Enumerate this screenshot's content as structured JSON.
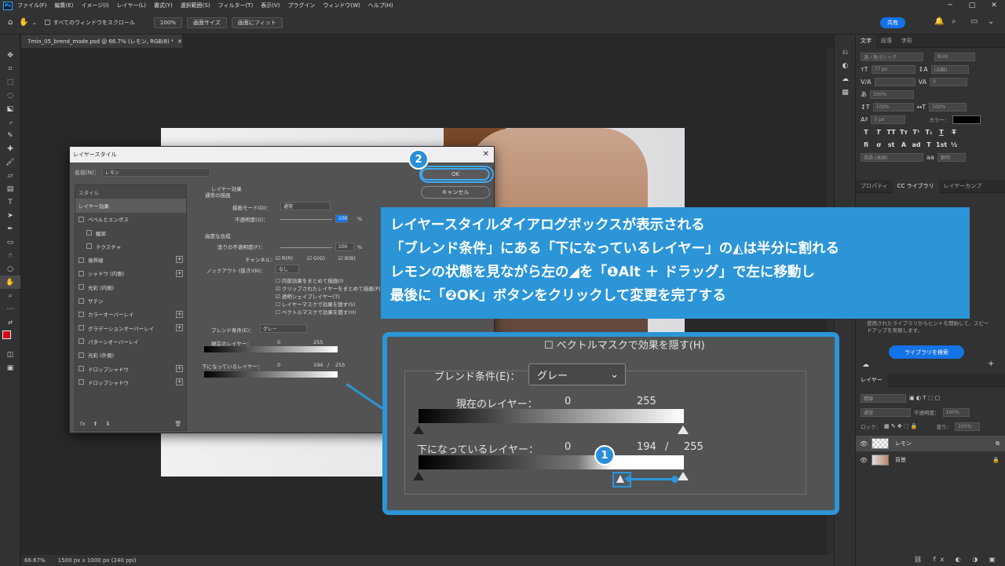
{
  "menu": {
    "logo": "Ps",
    "items": [
      "ファイル(F)",
      "編集(E)",
      "イメージ(I)",
      "レイヤー(L)",
      "書式(Y)",
      "選択範囲(S)",
      "フィルター(T)",
      "表示(V)",
      "プラグイン",
      "ウィンドウ(W)",
      "ヘルプ(H)"
    ]
  },
  "options": {
    "scroll_all": "すべてのウィンドウをスクロール",
    "zoom": "100%",
    "screen_size": "画面サイズ",
    "fit_screen": "画面にフィット",
    "share": "共有"
  },
  "document": {
    "tab_title": "7min_05_brend_mode.psd @ 66.7% (レモン, RGB/8) *",
    "status_zoom": "66.67%",
    "status_size": "1500 px x 1000 px (240 ppi)"
  },
  "right_panel": {
    "tabs_top": [
      "文字",
      "段落",
      "字形"
    ],
    "font_family": "源ノ角ゴシック",
    "font_style": "Bold",
    "font_size": "77 px",
    "leading": "(自動)",
    "tracking": "0",
    "scale_v": "100%",
    "scale_h": "100%",
    "baseline": "0 px",
    "color_label": "カラー：",
    "language": "英語 (米国)",
    "antialias": "鮮明",
    "tabs_mid": [
      "プロパティ",
      "CC ライブラリ",
      "レイヤーカンプ"
    ],
    "library_hint": "使用されたライブラリからヒントを開始して、スピードアップを実現します。",
    "library_button": "ライブラリを検索",
    "layers_tab": "レイヤー",
    "kind": "種類",
    "blend_mode": "通常",
    "opacity_label": "不透明度：",
    "opacity_value": "100%",
    "lock_label": "ロック：",
    "fill_label": "塗り：",
    "fill_value": "100%",
    "layers": [
      {
        "name": "レモン"
      },
      {
        "name": "背景"
      }
    ]
  },
  "dialog": {
    "title": "レイヤースタイル",
    "name_label": "名前(N)：",
    "name_value": "レモン",
    "style_header": "スタイル",
    "styles": [
      {
        "label": "レイヤー効果",
        "checkbox": false,
        "plus": false,
        "selected": true,
        "sub": false
      },
      {
        "label": "ベベルとエンボス",
        "checkbox": true,
        "plus": false,
        "selected": false,
        "sub": false
      },
      {
        "label": "輪郭",
        "checkbox": true,
        "plus": false,
        "selected": false,
        "sub": true
      },
      {
        "label": "テクスチャ",
        "checkbox": true,
        "plus": false,
        "selected": false,
        "sub": true
      },
      {
        "label": "境界線",
        "checkbox": true,
        "plus": true,
        "selected": false,
        "sub": false
      },
      {
        "label": "シャドウ (内側)",
        "checkbox": true,
        "plus": true,
        "selected": false,
        "sub": false
      },
      {
        "label": "光彩 (内側)",
        "checkbox": true,
        "plus": false,
        "selected": false,
        "sub": false
      },
      {
        "label": "サテン",
        "checkbox": true,
        "plus": false,
        "selected": false,
        "sub": false
      },
      {
        "label": "カラーオーバーレイ",
        "checkbox": true,
        "plus": true,
        "selected": false,
        "sub": false
      },
      {
        "label": "グラデーションオーバーレイ",
        "checkbox": true,
        "plus": true,
        "selected": false,
        "sub": false
      },
      {
        "label": "パターンオーバーレイ",
        "checkbox": true,
        "plus": false,
        "selected": false,
        "sub": false
      },
      {
        "label": "光彩 (外側)",
        "checkbox": true,
        "plus": false,
        "selected": false,
        "sub": false
      },
      {
        "label": "ドロップシャドウ",
        "checkbox": true,
        "plus": true,
        "selected": false,
        "sub": false
      },
      {
        "label": "ドロップシャドウ",
        "checkbox": true,
        "plus": true,
        "selected": false,
        "sub": false
      }
    ],
    "list_footer": "fx",
    "effects_title": "レイヤー効果",
    "general_blend": "通常の描画",
    "blend_mode_label": "描画モード(D)：",
    "blend_mode_value": "通常",
    "opacity_label": "不透明度(O)：",
    "opacity_value": "100",
    "percent": "%",
    "advanced_blend": "高度な合成",
    "fill_opacity_label": "塗りの不透明度(F)：",
    "fill_opacity_value": "100",
    "channels_label": "チャンネル：",
    "channel_r": "R(R)",
    "channel_g": "G(G)",
    "channel_b": "B(B)",
    "knockout_label": "ノックアウト (抜き)(N)：",
    "knockout_value": "なし",
    "opt1": "内部効果をまとめて描画(I)",
    "opt2": "クリップされたレイヤーをまとめて描画(P)",
    "opt3": "透明シェイプレイヤー(T)",
    "opt4": "レイヤーマスクで効果を隠す(S)",
    "opt5": "ベクトルマスクで効果を隠す(H)",
    "blend_if_label": "ブレンド条件(E)：",
    "blend_if_value": "グレー",
    "this_layer": "現在のレイヤー：",
    "underlying": "下になっているレイヤー：",
    "v0": "0",
    "v255": "255",
    "v194": "194",
    "slash": "/",
    "ok": "OK",
    "cancel": "キャンセル"
  },
  "callout": {
    "line1": "レイヤースタイルダイアログボックスが表示される",
    "line2": "「ブレンド条件」にある「下になっているレイヤー」の◭は半分に割れる",
    "line3": "レモンの状態を見ながら左の◢を「❶Alt ＋ ドラッグ」で左に移動し",
    "line4": "最後に「❷OK」ボタンをクリックして変更を完了する"
  },
  "zoom": {
    "vector_mask": "ベクトルマスクで効果を隠す(H)",
    "blend_if_label": "ブレンド条件(E)：",
    "blend_if_value": "グレー",
    "this_layer": "現在のレイヤー：",
    "underlying": "下になっているレイヤー：",
    "v0": "0",
    "v255": "255",
    "v194": "194",
    "slash": "/"
  },
  "badges": {
    "one": "1",
    "two": "2"
  },
  "colors": {
    "accent": "#2b95d8",
    "share": "#1473e6",
    "foreground": "#d0021b"
  }
}
